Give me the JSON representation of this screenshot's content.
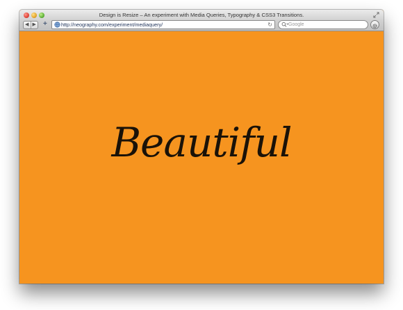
{
  "window": {
    "title": "Design is Resize – An experiment with Media Queries, Typography & CSS3 Transitions."
  },
  "toolbar": {
    "back_label": "◀",
    "forward_label": "▶",
    "add_label": "+",
    "address": "http://neography.com/experiment/mediaquery/",
    "reload_label": "↻",
    "search_placeholder": "Google"
  },
  "page": {
    "hero_text": "Beautiful",
    "background_color": "#f6941f"
  }
}
